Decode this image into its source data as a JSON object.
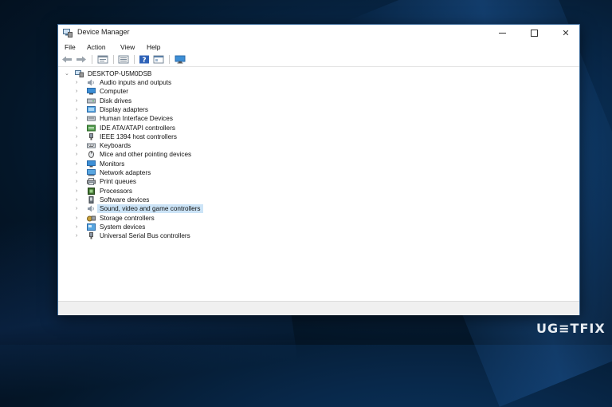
{
  "window": {
    "title": "Device Manager",
    "controls": {
      "minimize": "",
      "maximize": "",
      "close": "✕"
    }
  },
  "menu": [
    "File",
    "Action",
    "View",
    "Help"
  ],
  "toolbar": {
    "icons": [
      "back-arrow-icon",
      "forward-arrow-icon",
      "properties-icon",
      "device-list-icon",
      "help-icon",
      "console-icon",
      "monitor-icon"
    ]
  },
  "tree": {
    "root": {
      "label": "DESKTOP-U5M0DSB",
      "icon": "computer-icon"
    },
    "categories": [
      {
        "label": "Audio inputs and outputs",
        "icon": "speaker-icon"
      },
      {
        "label": "Computer",
        "icon": "computer-icon"
      },
      {
        "label": "Disk drives",
        "icon": "disk-drive-icon"
      },
      {
        "label": "Display adapters",
        "icon": "display-adapter-icon"
      },
      {
        "label": "Human Interface Devices",
        "icon": "hid-icon"
      },
      {
        "label": "IDE ATA/ATAPI controllers",
        "icon": "ide-controller-icon"
      },
      {
        "label": "IEEE 1394 host controllers",
        "icon": "firewire-icon"
      },
      {
        "label": "Keyboards",
        "icon": "keyboard-icon"
      },
      {
        "label": "Mice and other pointing devices",
        "icon": "mouse-icon"
      },
      {
        "label": "Monitors",
        "icon": "monitor-icon"
      },
      {
        "label": "Network adapters",
        "icon": "network-adapter-icon"
      },
      {
        "label": "Print queues",
        "icon": "printer-icon"
      },
      {
        "label": "Processors",
        "icon": "processor-icon"
      },
      {
        "label": "Software devices",
        "icon": "software-device-icon"
      },
      {
        "label": "Sound, video and game controllers",
        "icon": "sound-controller-icon"
      },
      {
        "label": "Storage controllers",
        "icon": "storage-controller-icon"
      },
      {
        "label": "System devices",
        "icon": "system-device-icon"
      },
      {
        "label": "Universal Serial Bus controllers",
        "icon": "usb-icon"
      }
    ],
    "selected_index": 14
  },
  "watermark": "UG≡TFIX",
  "colors": {
    "selection": "#cce4f7",
    "accent": "#2a7fd4"
  }
}
